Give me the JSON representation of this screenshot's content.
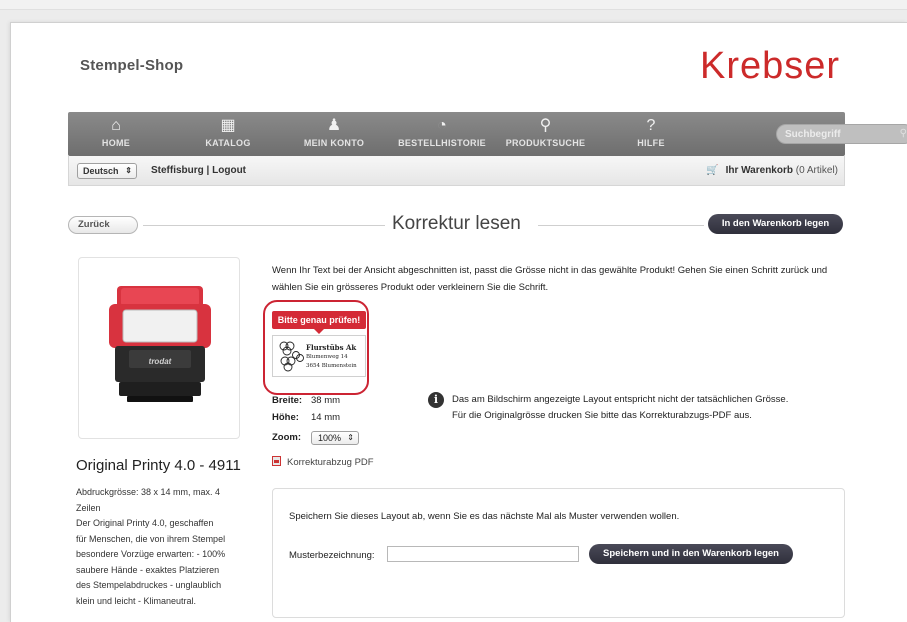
{
  "header": {
    "shop_title": "Stempel-Shop",
    "logo_text": "Krebser",
    "logo_color": "#cc2a2a"
  },
  "nav": {
    "items": [
      {
        "label": "HOME",
        "icon": "home-icon"
      },
      {
        "label": "KATALOG",
        "icon": "catalog-icon"
      },
      {
        "label": "MEIN KONTO",
        "icon": "user-icon"
      },
      {
        "label": "BESTELLHISTORIE",
        "icon": "history-icon"
      },
      {
        "label": "PRODUKTSUCHE",
        "icon": "search-icon"
      },
      {
        "label": "HILFE",
        "icon": "help-icon"
      }
    ],
    "search_placeholder": "Suchbegriff"
  },
  "subbar": {
    "language": "Deutsch",
    "account": "Steffisburg | Logout",
    "cart_label": "Ihr Warenkorb",
    "cart_count": "(0 Artikel)"
  },
  "page": {
    "back_label": "Zurück",
    "title": "Korrektur lesen",
    "add_to_cart_label": "In den Warenkorb legen",
    "accent_color": "#d42a36"
  },
  "product": {
    "name": "Original Printy 4.0 - 4911",
    "description_lines": [
      "Abdruckgrösse: 38 x 14 mm, max. 4",
      "Zeilen",
      "Der Original Printy 4.0, geschaffen",
      "für Menschen, die von ihrem Stempel",
      "besondere Vorzüge erwarten: - 100%",
      "saubere Hände - exaktes Platzieren",
      "des Stempelabdruckes - unglaublich",
      "klein und leicht - Klimaneutral."
    ],
    "stamp_brand": "trodat"
  },
  "info": {
    "text": "Wenn Ihr Text bei der Ansicht abgeschnitten ist, passt die Grösse nicht in das gewählte Produkt! Gehen Sie einen Schritt zurück und wählen Sie ein grösseres Produkt oder verkleinern Sie die Schrift."
  },
  "preview": {
    "badge": "Bitte genau prüfen!",
    "lines": [
      "Flurstübs Ak",
      "Blumenweg 14",
      "3654 Blumenstein"
    ]
  },
  "dimensions": {
    "width_label": "Breite:",
    "width_value": "38 mm",
    "height_label": "Höhe:",
    "height_value": "14 mm",
    "zoom_label": "Zoom:",
    "zoom_value": "100%",
    "pdf_label": "Korrekturabzug PDF"
  },
  "note": {
    "icon": "info-icon",
    "text": "Das am Bildschirm angezeigte Layout entspricht nicht der tatsächlichen Grösse. Für die Originalgrösse drucken Sie bitte das Korrekturabzugs-PDF aus."
  },
  "save": {
    "description": "Speichern Sie dieses Layout ab, wenn Sie es das nächste Mal als Muster verwenden wollen.",
    "field_label": "Musterbezeichnung:",
    "field_value": "",
    "button_label": "Speichern und in den Warenkorb legen"
  }
}
